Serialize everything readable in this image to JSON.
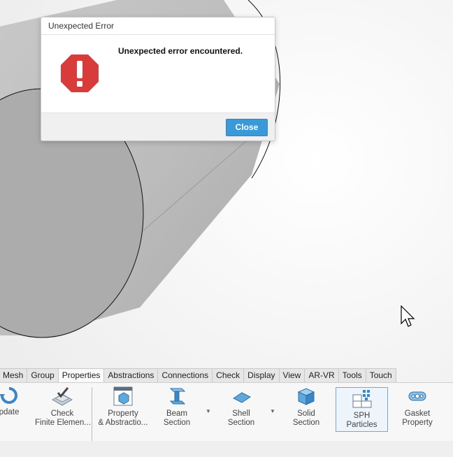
{
  "dialog": {
    "title": "Unexpected Error",
    "message": "Unexpected error encountered.",
    "close_label": "Close"
  },
  "ribbon": {
    "tabs": [
      "Mesh",
      "Group",
      "Properties",
      "Abstractions",
      "Connections",
      "Check",
      "Display",
      "View",
      "AR-VR",
      "Tools",
      "Touch"
    ],
    "active_tab": "Properties",
    "tools": [
      {
        "line1": "pdate",
        "line2": ""
      },
      {
        "line1": "Check",
        "line2": "Finite Elemen..."
      },
      {
        "line1": "Property",
        "line2": "& Abstractio..."
      },
      {
        "line1": "Beam",
        "line2": "Section"
      },
      {
        "line1": "Shell",
        "line2": "Section"
      },
      {
        "line1": "Solid",
        "line2": "Section"
      },
      {
        "line1": "SPH",
        "line2": "Particles"
      },
      {
        "line1": "Gasket",
        "line2": "Property"
      }
    ]
  },
  "colors": {
    "accent": "#3a9ad9",
    "error": "#d93a3a",
    "cylinder": "#b4b4b4"
  }
}
